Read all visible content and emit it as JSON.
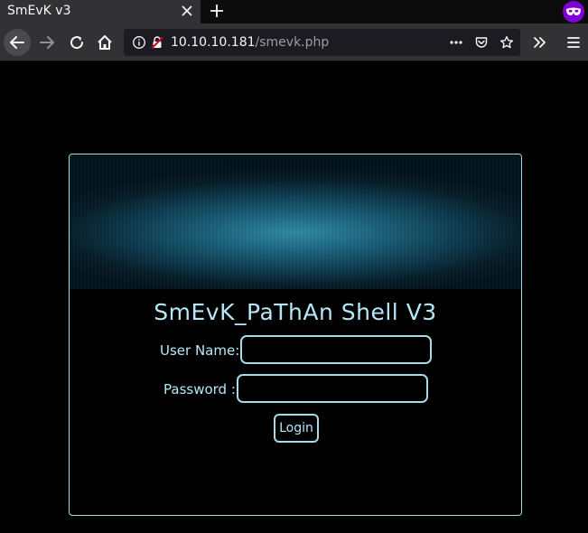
{
  "browser": {
    "tab_title": "SmEvK v3",
    "url_host": "10.10.10.181",
    "url_path": "/smevk.php",
    "icons": {
      "tab_close": "close-icon",
      "new_tab": "plus-icon",
      "private_browsing": "private-mask-icon",
      "back": "arrow-left-icon",
      "forward": "arrow-right-icon",
      "reload": "reload-icon",
      "home": "home-icon",
      "site_info": "info-icon",
      "insecure": "insecure-lock-icon",
      "page_actions": "more-dots-icon",
      "pocket": "pocket-icon",
      "bookmark": "star-icon",
      "overflow": "double-chevron-icon",
      "menu": "hamburger-icon"
    }
  },
  "page": {
    "title": "SmEvK_PaThAn Shell V3",
    "username_label": "User Name:",
    "password_label": "Password :",
    "username_value": "",
    "password_value": "",
    "login_label": "Login",
    "colors": {
      "accent": "#b4e8f7",
      "border": "#a6dbe8",
      "background": "#000000"
    }
  }
}
